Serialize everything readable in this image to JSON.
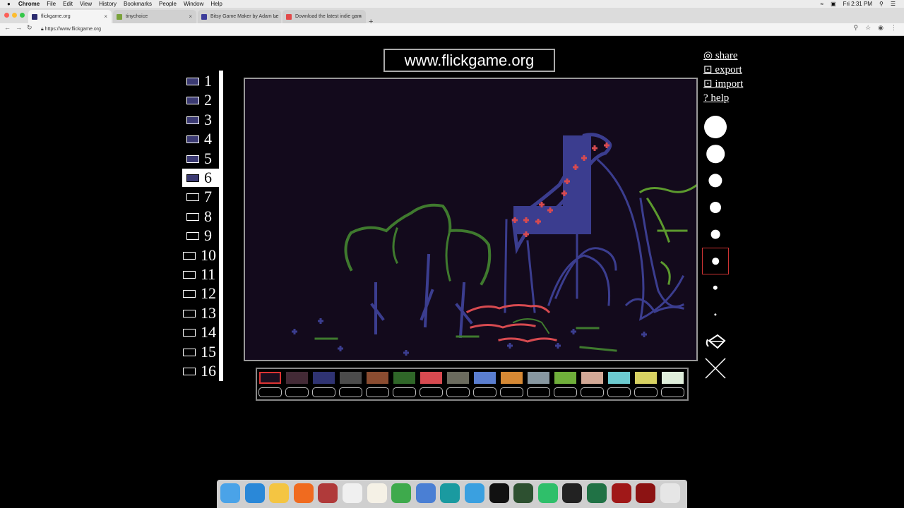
{
  "menubar": {
    "apple": "",
    "menus": [
      "Chrome",
      "File",
      "Edit",
      "View",
      "History",
      "Bookmarks",
      "People",
      "Window",
      "Help"
    ],
    "clock": "Fri 2:31 PM"
  },
  "tabs": [
    {
      "label": "flickgame.org",
      "active": true,
      "favicon_color": "#2a2a6e"
    },
    {
      "label": "tinychoice",
      "active": false,
      "favicon_color": "#7aa23a"
    },
    {
      "label": "Bitsy Game Maker by Adam Le",
      "active": false,
      "favicon_color": "#3b3b9a"
    },
    {
      "label": "Download the latest indie gam",
      "active": false,
      "favicon_color": "#e24a4a"
    }
  ],
  "address": {
    "url": "https://www.flickgame.org"
  },
  "page": {
    "title": "www.flickgame.org",
    "links": [
      {
        "icon": "◎",
        "label": "share"
      },
      {
        "icon": "⊡",
        "label": "export"
      },
      {
        "icon": "⊡",
        "label": "import"
      },
      {
        "icon": "?",
        "label": "help"
      }
    ],
    "frames": [
      {
        "num": "1",
        "has_image": true
      },
      {
        "num": "2",
        "has_image": true
      },
      {
        "num": "3",
        "has_image": true
      },
      {
        "num": "4",
        "has_image": true
      },
      {
        "num": "5",
        "has_image": true
      },
      {
        "num": "6",
        "has_image": true,
        "selected": true
      },
      {
        "num": "7",
        "has_image": false
      },
      {
        "num": "8",
        "has_image": false
      },
      {
        "num": "9",
        "has_image": false
      },
      {
        "num": "10",
        "has_image": false
      },
      {
        "num": "11",
        "has_image": false
      },
      {
        "num": "12",
        "has_image": false
      },
      {
        "num": "13",
        "has_image": false
      },
      {
        "num": "14",
        "has_image": false
      },
      {
        "num": "15",
        "has_image": false
      },
      {
        "num": "16",
        "has_image": false
      }
    ],
    "palette": [
      "#1a0f1f",
      "#432a36",
      "#2f3372",
      "#4b4b4b",
      "#8a4c30",
      "#2f6628",
      "#d74a50",
      "#6b6b5e",
      "#5a7ed0",
      "#d58834",
      "#8797a0",
      "#6fae3a",
      "#d2a896",
      "#6ccad0",
      "#d7d162",
      "#dfeedb"
    ],
    "selected_color_index": 0,
    "brush_sizes": [
      5,
      4,
      3,
      2.5,
      2,
      1.5,
      1,
      0.5
    ],
    "selected_brush_index": 5,
    "colors": {
      "canvas_bg": "#130a1c",
      "blue": "#3b3d8f",
      "green": "#3f7a2e",
      "red": "#d74a50",
      "bright_green": "#5c9a2e"
    }
  },
  "dock": [
    {
      "name": "finder-icon",
      "color": "#4aa3e8"
    },
    {
      "name": "safari-icon",
      "color": "#2a88d8"
    },
    {
      "name": "chrome-icon",
      "color": "#f4c542"
    },
    {
      "name": "firefox-icon",
      "color": "#f06b1f"
    },
    {
      "name": "dictionary-icon",
      "color": "#b03a3a"
    },
    {
      "name": "itunes-icon",
      "color": "#f0f0f0"
    },
    {
      "name": "textedit-icon",
      "color": "#f5f1e6"
    },
    {
      "name": "numbers-icon",
      "color": "#3eaa4c"
    },
    {
      "name": "keynote-icon",
      "color": "#4a7fd4"
    },
    {
      "name": "arduino-icon",
      "color": "#1a9aa0"
    },
    {
      "name": "comic-app-icon",
      "color": "#3aa0e0"
    },
    {
      "name": "unity-hub-icon",
      "color": "#111111"
    },
    {
      "name": "leap-icon",
      "color": "#2d5030"
    },
    {
      "name": "green-app-icon",
      "color": "#2fbf6a"
    },
    {
      "name": "unity-icon",
      "color": "#222222"
    },
    {
      "name": "excel-icon",
      "color": "#207245"
    },
    {
      "name": "acrobat-icon",
      "color": "#a01818"
    },
    {
      "name": "acrobat-folder-icon",
      "color": "#8c1313"
    },
    {
      "name": "trash-icon",
      "color": "#e6e6e6"
    }
  ]
}
